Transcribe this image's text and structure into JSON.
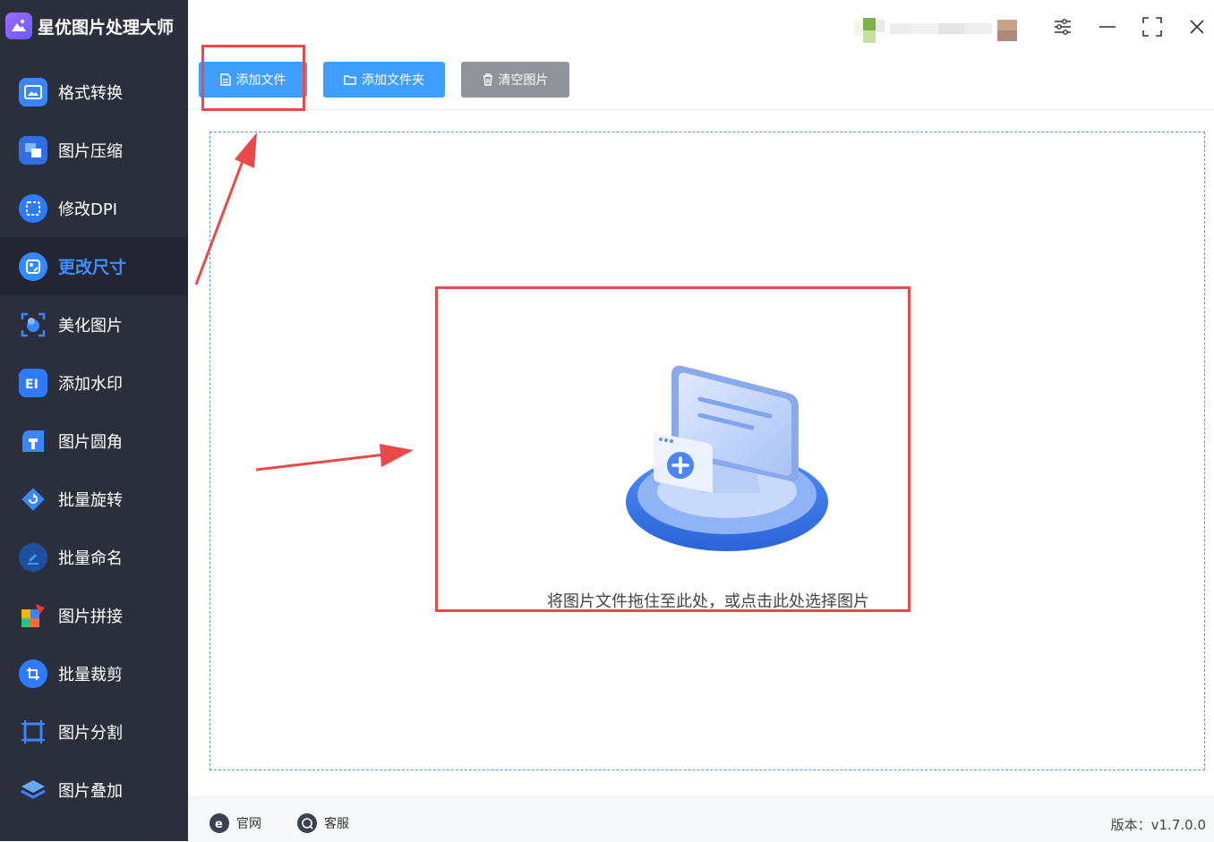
{
  "app": {
    "title": "星优图片处理大师"
  },
  "sidebar": {
    "items": [
      {
        "label": "格式转换",
        "icon": "image-convert-icon",
        "color": "#2f7bff"
      },
      {
        "label": "图片压缩",
        "icon": "image-compress-icon",
        "color": "#2f7bff"
      },
      {
        "label": "修改DPI",
        "icon": "dpi-icon",
        "color": "#2f7bff"
      },
      {
        "label": "更改尺寸",
        "icon": "resize-icon",
        "color": "#2f7bff",
        "active": true
      },
      {
        "label": "美化图片",
        "icon": "beautify-icon",
        "color": "#2f7bff"
      },
      {
        "label": "添加水印",
        "icon": "watermark-icon",
        "color": "#2f7bff"
      },
      {
        "label": "图片圆角",
        "icon": "rounded-corner-icon",
        "color": "#2f7bff"
      },
      {
        "label": "批量旋转",
        "icon": "rotate-icon",
        "color": "#2f7bff"
      },
      {
        "label": "批量命名",
        "icon": "rename-icon",
        "color": "#2f7bff"
      },
      {
        "label": "图片拼接",
        "icon": "stitch-icon",
        "color": "#ff8a00"
      },
      {
        "label": "批量裁剪",
        "icon": "crop-icon",
        "color": "#2f7bff"
      },
      {
        "label": "图片分割",
        "icon": "split-icon",
        "color": "#2f7bff"
      },
      {
        "label": "图片叠加",
        "icon": "overlay-icon",
        "color": "#2f7bff"
      }
    ]
  },
  "toolbar": {
    "add_file": "添加文件",
    "add_folder": "添加文件夹",
    "clear_images": "清空图片"
  },
  "dropzone": {
    "hint": "将图片文件拖住至此处，或点击此处选择图片"
  },
  "footer": {
    "website": "官网",
    "support": "客服",
    "version": "版本：v1.7.0.0"
  },
  "colors": {
    "sidebar_bg": "#2b2f3b",
    "accent": "#409eff",
    "annotation_red": "#e84a4a"
  }
}
